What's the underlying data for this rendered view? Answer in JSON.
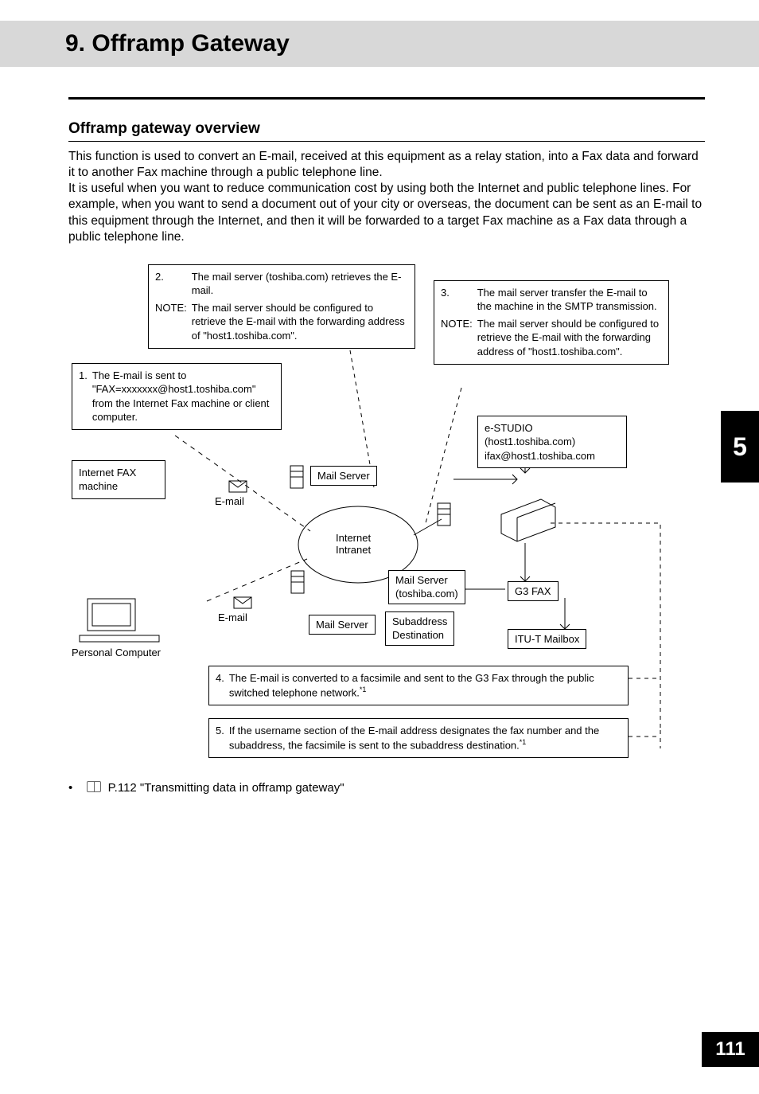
{
  "header": {
    "title": "9. Offramp Gateway"
  },
  "section": {
    "heading": "Offramp gateway overview"
  },
  "intro": "This function is used to convert an E-mail, received at this equipment as a relay station, into a Fax data and forward it to another Fax machine through a public telephone line.\nIt is useful when you want to reduce communication cost by using both the Internet and public telephone lines. For example, when you want to send a document out of your city or overseas, the document can be sent as an E-mail to this equipment through the Internet, and then it will be forwarded to a target Fax machine as a Fax data through a public telephone line.",
  "boxes": {
    "step2": {
      "num": "2.",
      "text": "The mail server (toshiba.com) retrieves the E-mail.",
      "note_label": "NOTE:",
      "note": "The mail server should be configured to retrieve the E-mail with the forwarding address of \"host1.toshiba.com\"."
    },
    "step3": {
      "num": "3.",
      "text": "The mail server transfer the E-mail to the machine in the SMTP transmission.",
      "note_label": "NOTE:",
      "note": "The mail server should be configured to retrieve the E-mail with the forwarding address of \"host1.toshiba.com\"."
    },
    "step1": {
      "num": "1.",
      "text": "The E-mail is sent to \"FAX=xxxxxxx@host1.toshiba.com\" from the Internet Fax machine or client computer."
    },
    "ifax_label": "Internet FAX\nmachine",
    "email1": "E-mail",
    "email2": "E-mail",
    "pc": "Personal Computer",
    "mailserver1": "Mail Server",
    "internet": "Internet\nIntranet",
    "mailserver2": "Mail Server\n(toshiba.com)",
    "mailserver3": "Mail Server",
    "sub": "Subaddress\nDestination",
    "estudio": "e-STUDIO\n(host1.toshiba.com)\nifax@host1.toshiba.com",
    "g3": "G3 FAX",
    "itu": "ITU-T Mailbox",
    "step4": {
      "num": "4.",
      "text": "The E-mail is converted to a facsimile and sent to the G3 Fax through the public switched telephone network."
    },
    "step5": {
      "num": "5.",
      "text": "If the username section of the E-mail address designates the fax number and the subaddress, the facsimile is sent to the subaddress destination."
    },
    "footnote": "*1"
  },
  "reference": {
    "bullet": "•",
    "text": "P.112 \"Transmitting data in offramp gateway\""
  },
  "tab": "5",
  "page_num": "111"
}
